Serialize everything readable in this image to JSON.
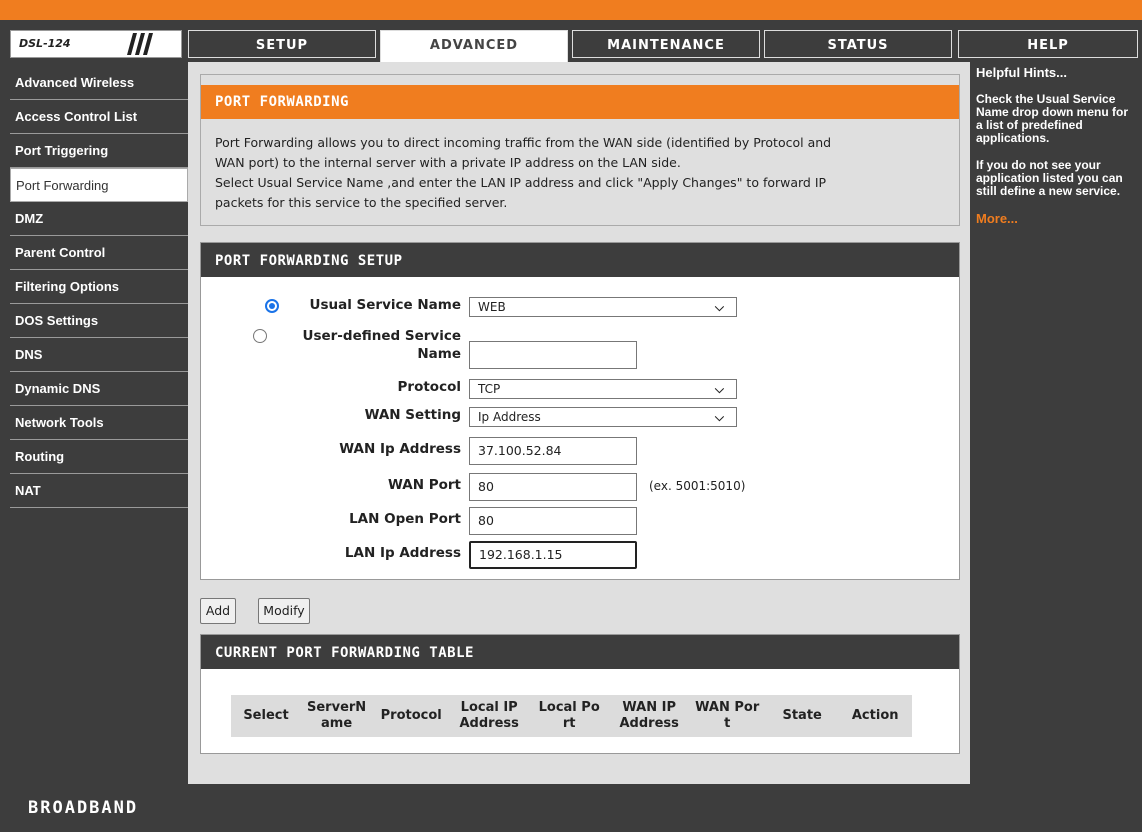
{
  "header": {
    "model": "DSL-124",
    "tabs": [
      {
        "label": "SETUP"
      },
      {
        "label": "ADVANCED"
      },
      {
        "label": "MAINTENANCE"
      },
      {
        "label": "STATUS"
      },
      {
        "label": "HELP"
      }
    ],
    "active_tab": "ADVANCED"
  },
  "sidebar": {
    "items": [
      {
        "label": "Advanced Wireless"
      },
      {
        "label": "Access Control List"
      },
      {
        "label": "Port Triggering"
      },
      {
        "label": "Port Forwarding"
      },
      {
        "label": "DMZ"
      },
      {
        "label": "Parent Control"
      },
      {
        "label": "Filtering Options"
      },
      {
        "label": "DOS Settings"
      },
      {
        "label": "DNS"
      },
      {
        "label": "Dynamic DNS"
      },
      {
        "label": "Network Tools"
      },
      {
        "label": "Routing"
      },
      {
        "label": "NAT"
      }
    ],
    "active_item": "Port Forwarding"
  },
  "intro": {
    "title": "PORT FORWARDING",
    "line1": "Port Forwarding allows you to direct incoming traffic from the WAN side (identified by Protocol and",
    "line2": "WAN port) to the internal server with a private IP address on the LAN side.",
    "line3": "Select Usual Service Name ,and enter the LAN IP address and click \"Apply Changes\" to forward IP",
    "line4": "packets for this service to the specified server."
  },
  "setup": {
    "title": "PORT FORWARDING SETUP",
    "usual_service_label": "Usual Service Name",
    "usual_service_value": "WEB",
    "user_defined_label_1": "User-defined Service",
    "user_defined_label_2": "Name",
    "user_defined_value": "",
    "protocol_label": "Protocol",
    "protocol_value": "TCP",
    "wan_setting_label": "WAN Setting",
    "wan_setting_value": "Ip Address",
    "wan_ip_label": "WAN Ip Address",
    "wan_ip_value": "37.100.52.84",
    "wan_port_label": "WAN Port",
    "wan_port_value": "80",
    "wan_port_hint": "(ex. 5001:5010)",
    "lan_open_port_label": "LAN Open Port",
    "lan_open_port_value": "80",
    "lan_ip_label": "LAN Ip Address",
    "lan_ip_value": "192.168.1.15",
    "selected_radio": "usual"
  },
  "buttons": {
    "add": "Add",
    "modify": "Modify"
  },
  "table": {
    "title": "CURRENT PORT FORWARDING TABLE",
    "columns": [
      {
        "l1": "Select",
        "l2": ""
      },
      {
        "l1": "ServerN",
        "l2": "ame"
      },
      {
        "l1": "Protocol",
        "l2": ""
      },
      {
        "l1": "Local IP",
        "l2": "Address"
      },
      {
        "l1": "Local Po",
        "l2": "rt"
      },
      {
        "l1": "WAN IP",
        "l2": "Address"
      },
      {
        "l1": "WAN Por",
        "l2": "t"
      },
      {
        "l1": "State",
        "l2": ""
      },
      {
        "l1": "Action",
        "l2": ""
      }
    ]
  },
  "hints": {
    "title": "Helpful Hints...",
    "p1": "Check the Usual Service Name drop down menu for a list of predefined applications.",
    "p2": "If you do not see your application listed you can still define a new service.",
    "more": "More..."
  },
  "footer": {
    "brand": "BROADBAND"
  },
  "colors": {
    "accent": "#f07d1f",
    "dark": "#3d3d3d",
    "panel": "#dfdfdf",
    "radio": "#1a73e8"
  }
}
